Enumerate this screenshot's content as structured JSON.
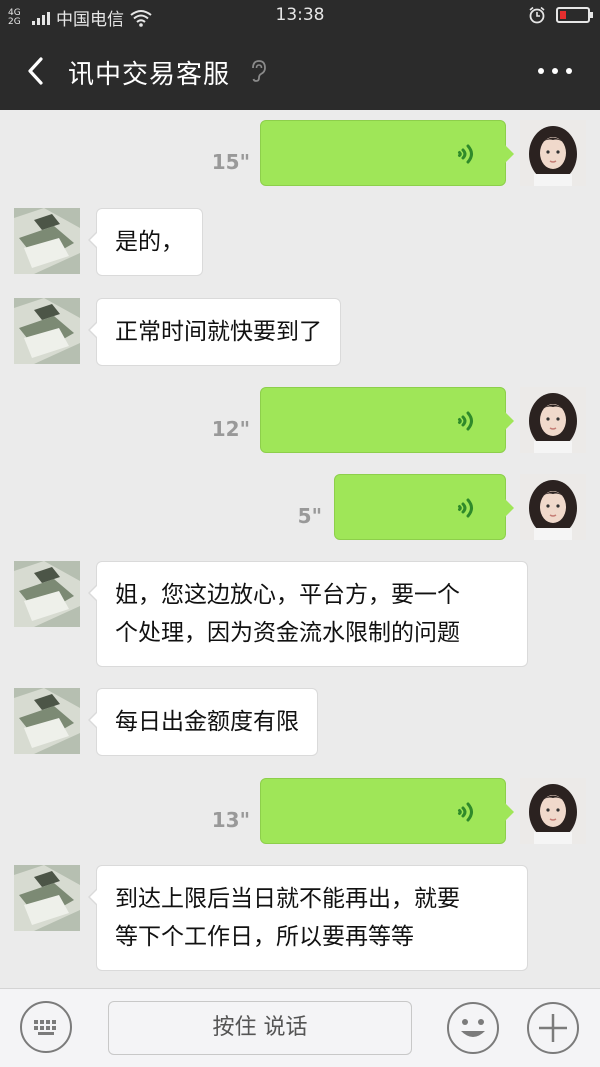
{
  "status_bar": {
    "signal_label": "4G 2G",
    "carrier": "中国电信",
    "time": "13:38",
    "battery_color": "#e52e2e"
  },
  "header": {
    "back_icon": "chevron-left-icon",
    "title": "讯中交易客服",
    "ear_icon": "ear-icon",
    "more_icon": "more-dots-icon"
  },
  "messages": [
    {
      "sender": "me",
      "type": "voice",
      "duration": "15\""
    },
    {
      "sender": "other",
      "type": "text",
      "lines": [
        "是的，"
      ]
    },
    {
      "sender": "other",
      "type": "text",
      "lines": [
        "正常时间就快要到了"
      ]
    },
    {
      "sender": "me",
      "type": "voice",
      "duration": "12\""
    },
    {
      "sender": "me",
      "type": "voice",
      "duration": "5\""
    },
    {
      "sender": "other",
      "type": "text",
      "lines": [
        "姐，您这边放心，平台方，要一个",
        "个处理，因为资金流水限制的问题"
      ]
    },
    {
      "sender": "other",
      "type": "text",
      "lines": [
        "每日出金额度有限"
      ]
    },
    {
      "sender": "me",
      "type": "voice",
      "duration": "13\""
    },
    {
      "sender": "other",
      "type": "text",
      "lines": [
        "到达上限后当日就不能再出，就要",
        "等下个工作日，所以要再等等"
      ]
    }
  ],
  "input_bar": {
    "keyboard_icon": "keyboard-icon",
    "hold_to_talk_label": "按住 说话",
    "emoji_icon": "smiley-icon",
    "plus_icon": "plus-icon"
  },
  "colors": {
    "voice_bubble": "#9fe658",
    "header_bg": "#2b2b2b",
    "chat_bg": "#ebebeb"
  }
}
